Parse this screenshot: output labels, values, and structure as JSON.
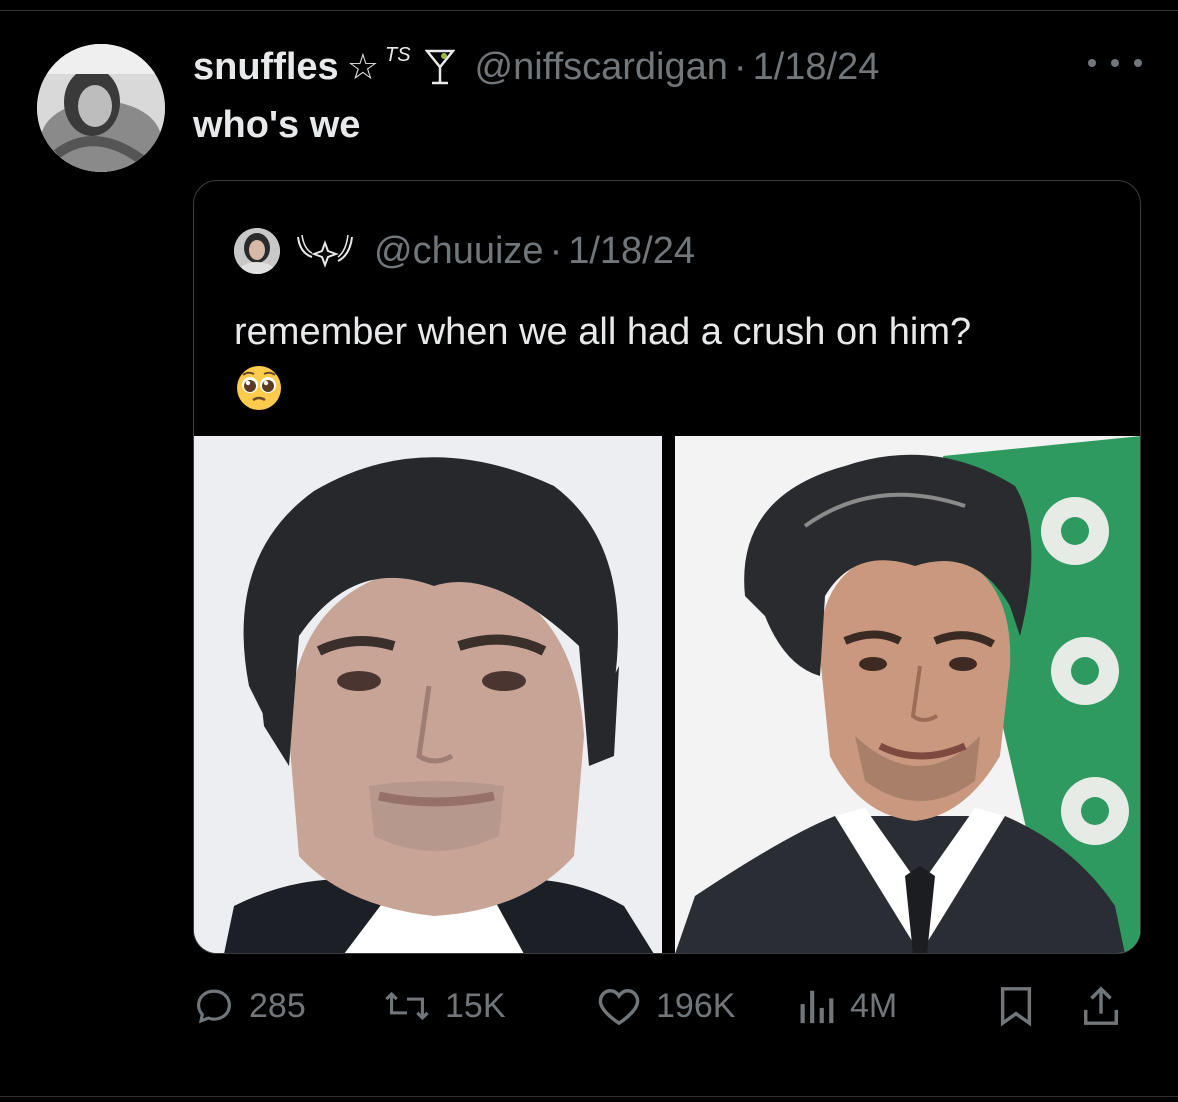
{
  "tweet": {
    "author_name": "snuffles",
    "author_badge_text": "TS",
    "author_handle": "@niffscardigan",
    "separator": "·",
    "date": "1/18/24",
    "text": "who's we"
  },
  "quoted_tweet": {
    "author_handle": "@chuuize",
    "separator": "·",
    "date": "1/18/24",
    "text": "remember when we all had a crush on him?",
    "emoji": "pleading-face"
  },
  "actions": {
    "replies": "285",
    "reposts": "15K",
    "likes": "196K",
    "views": "4M"
  },
  "icons": [
    "star-icon",
    "martini-icon",
    "more-icon",
    "reply-icon",
    "repost-icon",
    "like-icon",
    "views-icon",
    "bookmark-icon",
    "share-icon"
  ],
  "colors": {
    "background": "#000000",
    "text": "#e7e9ea",
    "muted": "#71767b",
    "border": "#2f3336"
  }
}
